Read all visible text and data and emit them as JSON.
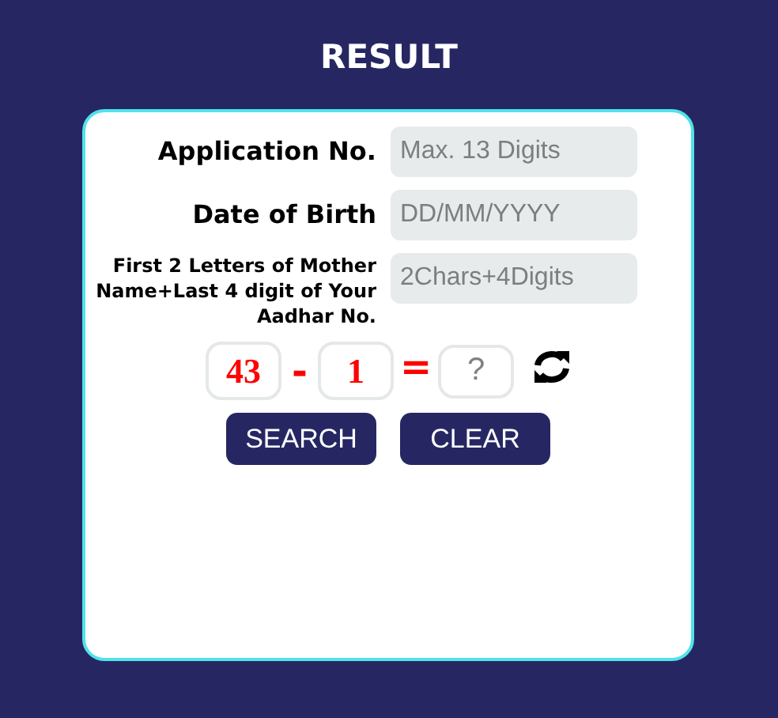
{
  "title": "RESULT",
  "fields": [
    {
      "label": "Application No.",
      "placeholder": "Max. 13 Digits",
      "kind": "large"
    },
    {
      "label": "Date of Birth",
      "placeholder": "DD/MM/YYYY",
      "kind": "large"
    },
    {
      "label": "First 2 Letters of Mother Name+Last 4 digit of Your Aadhar No.",
      "placeholder": "2Chars+4Digits",
      "kind": "small"
    }
  ],
  "captcha": {
    "operand_1": "43",
    "operator": "-",
    "operand_2": "1",
    "equals": "=",
    "answer_placeholder": "?"
  },
  "buttons": [
    "SEARCH",
    "CLEAR"
  ]
}
